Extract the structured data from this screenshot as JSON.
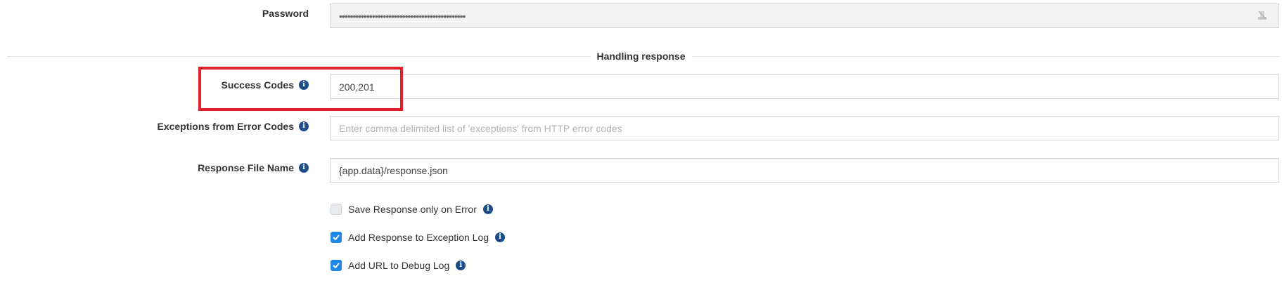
{
  "password": {
    "label": "Password",
    "value": "••••••••••••••••••••••••••••••••••••••••••••••",
    "toggle_icon": "eye-slash-icon"
  },
  "section": {
    "title": "Handling response"
  },
  "success_codes": {
    "label": "Success Codes",
    "value": "200,201",
    "placeholder": "",
    "info_icon": "info-icon"
  },
  "exceptions": {
    "label": "Exceptions from Error Codes",
    "value": "",
    "placeholder": "Enter comma delimited list of 'exceptions' from HTTP error codes",
    "info_icon": "info-icon"
  },
  "response_file": {
    "label": "Response File Name",
    "value": "{app.data}/response.json",
    "placeholder": "",
    "info_icon": "info-icon"
  },
  "options": [
    {
      "label": "Save Response only on Error",
      "checked": false
    },
    {
      "label": "Add Response to Exception Log",
      "checked": true
    },
    {
      "label": "Add URL to Debug Log",
      "checked": true
    }
  ],
  "colors": {
    "accent": "#1e88e5",
    "info_icon": "#1d4e89",
    "highlight": "#e0202a"
  }
}
